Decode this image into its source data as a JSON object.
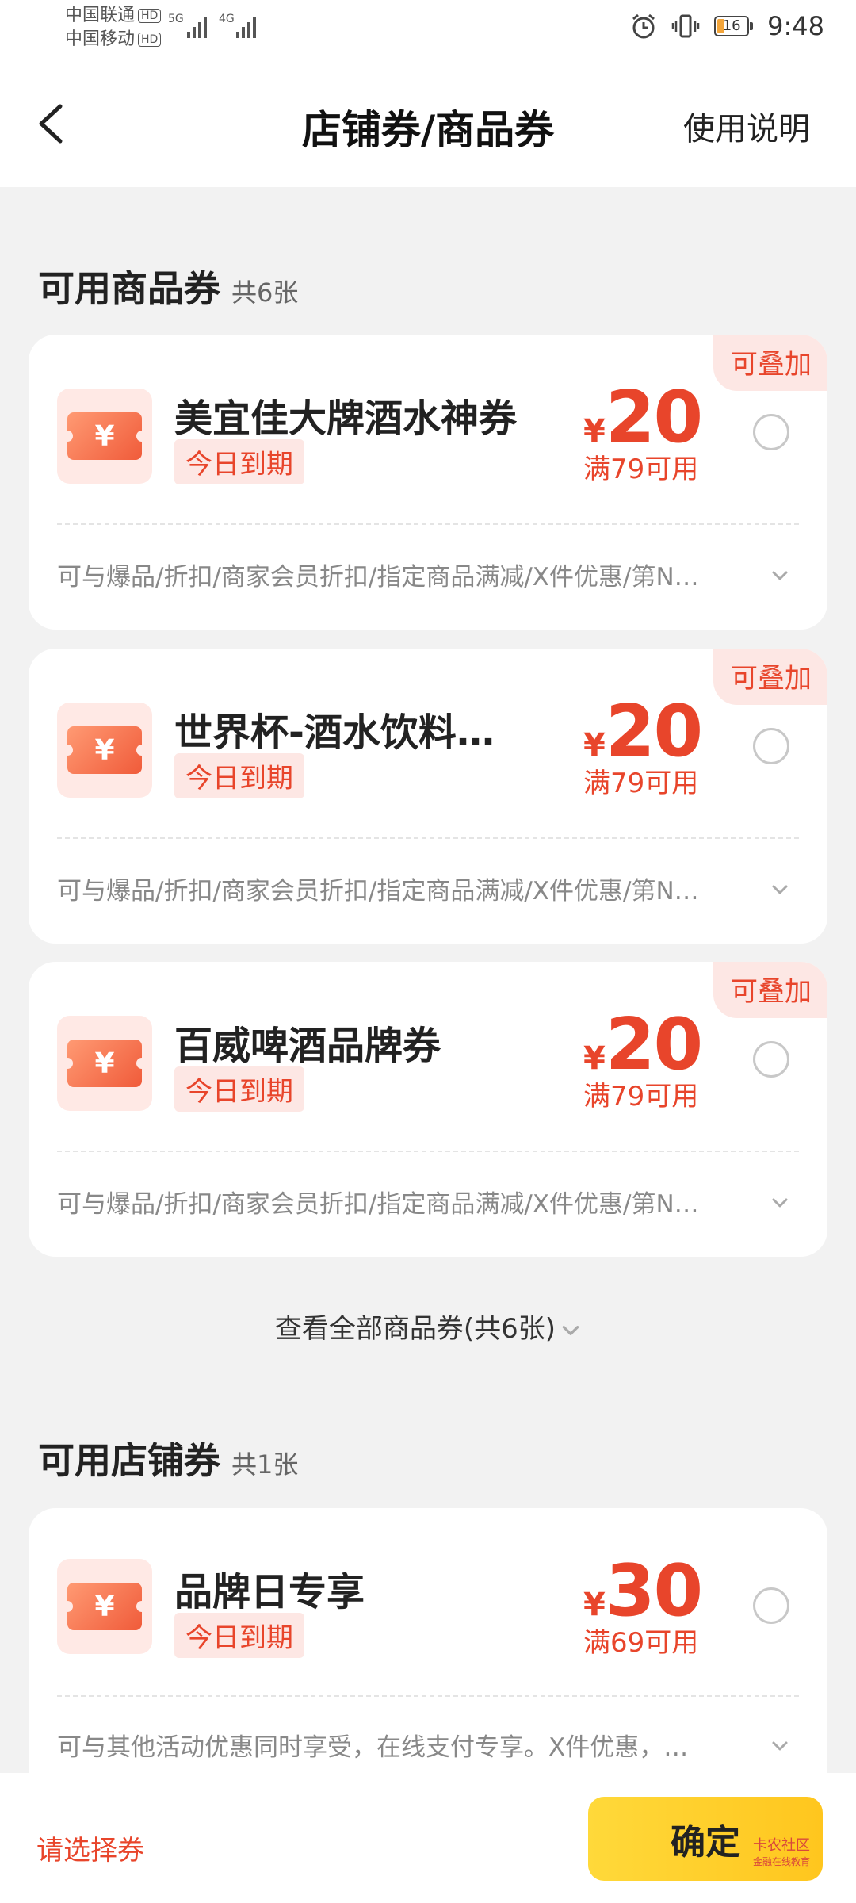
{
  "status_bar": {
    "carrier_1": "中国联通",
    "carrier_2": "中国移动",
    "hd_badge": "HD",
    "net_1": "5G",
    "net_2": "4G",
    "battery_level": "16",
    "time": "9:48"
  },
  "nav": {
    "title": "店铺券/商品券",
    "right_link": "使用说明"
  },
  "product_section": {
    "title": "可用商品券",
    "count": "共6张",
    "coupons": [
      {
        "tag": "可叠加",
        "name": "美宜佳大牌酒水神券",
        "expiry": "今日到期",
        "currency": "¥",
        "amount": "20",
        "condition": "满79可用",
        "description": "可与爆品/折扣/商家会员折扣/指定商品满减/X件优惠/第N…"
      },
      {
        "tag": "可叠加",
        "name": "世界杯-酒水饮料食…",
        "expiry": "今日到期",
        "currency": "¥",
        "amount": "20",
        "condition": "满79可用",
        "description": "可与爆品/折扣/商家会员折扣/指定商品满减/X件优惠/第N…"
      },
      {
        "tag": "可叠加",
        "name": "百威啤酒品牌券",
        "expiry": "今日到期",
        "currency": "¥",
        "amount": "20",
        "condition": "满79可用",
        "description": "可与爆品/折扣/商家会员折扣/指定商品满减/X件优惠/第N…"
      }
    ],
    "view_all": "查看全部商品券(共6张)"
  },
  "store_section": {
    "title": "可用店铺券",
    "count": "共1张",
    "coupons": [
      {
        "name": "品牌日专享",
        "expiry": "今日到期",
        "currency": "¥",
        "amount": "30",
        "condition": "满69可用",
        "description": "可与其他活动优惠同时享受，在线支付专享。X件优惠，…"
      }
    ]
  },
  "bottom": {
    "choose_label": "请选择券",
    "confirm_label": "确定",
    "watermark_1": "卡农社区",
    "watermark_2": "金融在线教育"
  },
  "colors": {
    "accent": "#e8452b",
    "confirm": "#ffcc22",
    "background": "#f2f2f2"
  }
}
